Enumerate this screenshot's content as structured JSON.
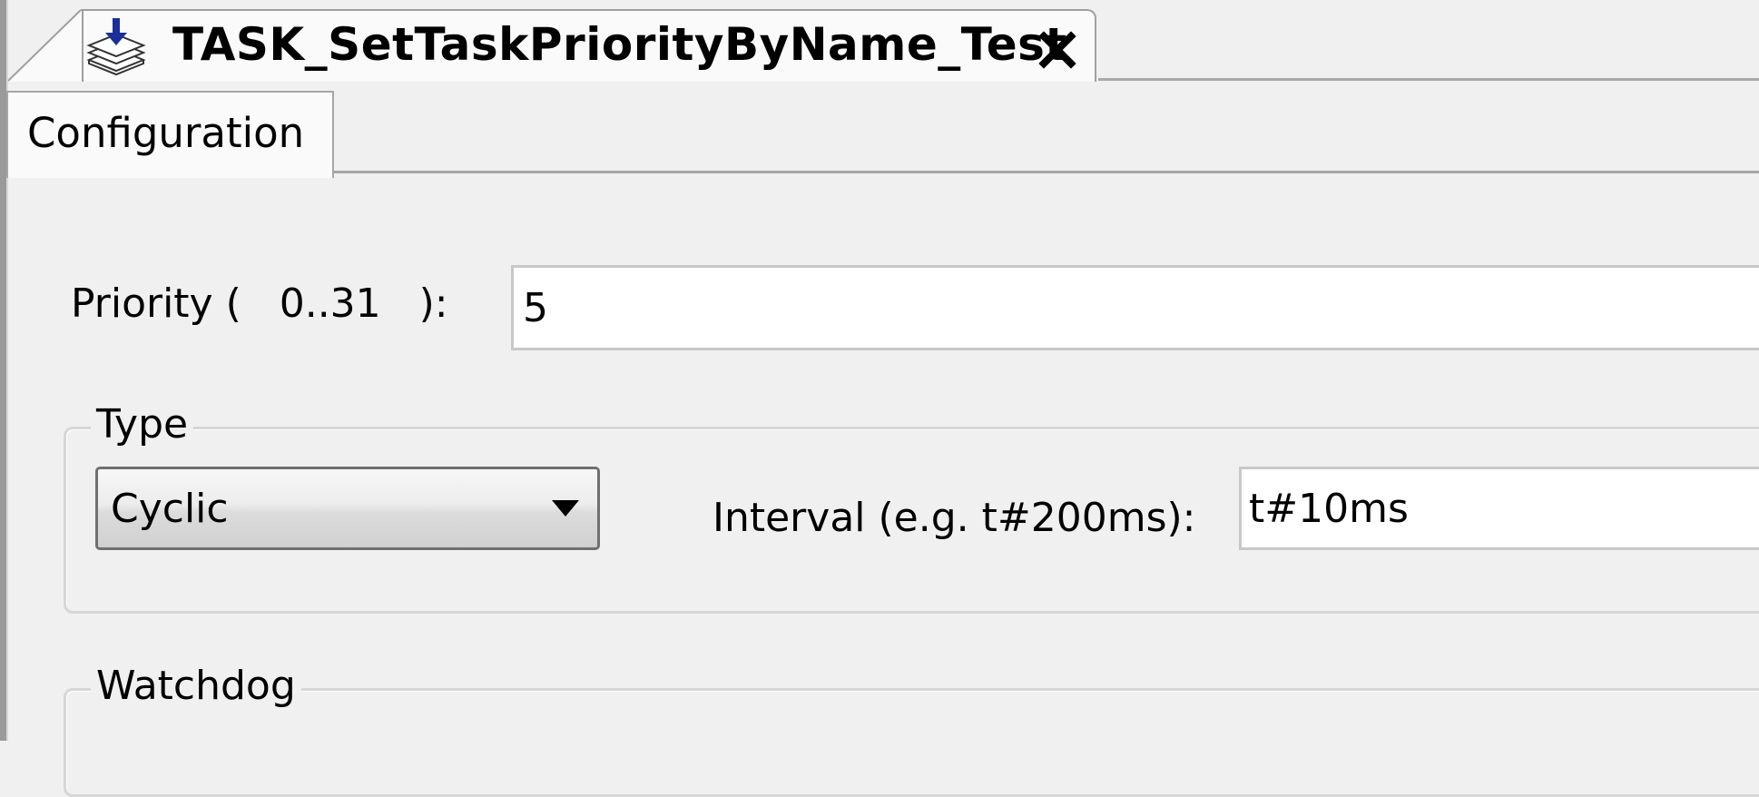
{
  "document_tab": {
    "title": "TASK_SetTaskPriorityByName_Test",
    "icon": "task-stack-icon",
    "close_icon": "close-icon"
  },
  "editor_tabs": [
    {
      "label": "Configuration",
      "active": true
    }
  ],
  "priority": {
    "label": "Priority (   0..31   ):",
    "value": "5"
  },
  "type_group": {
    "legend": "Type",
    "type_value": "Cyclic",
    "interval_label": "Interval (e.g. t#200ms):",
    "interval_value": "t#10ms"
  },
  "watchdog_group": {
    "legend": "Watchdog"
  },
  "colors": {
    "background": "#f0f0f0",
    "active_tab": "#fafafa",
    "border": "#a6a6a6",
    "icon_accent": "#1a2f9a"
  }
}
